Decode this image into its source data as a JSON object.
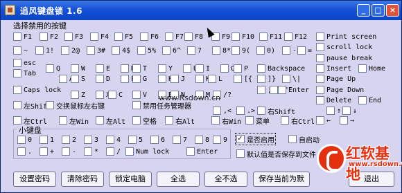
{
  "window": {
    "title": "追风键盘锁 1.6",
    "min": "_",
    "max": "□",
    "close": "×"
  },
  "section_title": "选择禁用的按键",
  "keys": [
    {
      "id": "F1",
      "label": "F1",
      "checked": false
    },
    {
      "id": "F2",
      "label": "F2",
      "checked": false
    },
    {
      "id": "F3",
      "label": "F3",
      "checked": false
    },
    {
      "id": "F4",
      "label": "F4",
      "checked": false
    },
    {
      "id": "F5",
      "label": "F5",
      "checked": false
    },
    {
      "id": "F6",
      "label": "F6",
      "checked": false
    },
    {
      "id": "F7",
      "label": "F7",
      "checked": false
    },
    {
      "id": "F8",
      "label": "F8",
      "checked": false
    },
    {
      "id": "F9",
      "label": "F9",
      "checked": false
    },
    {
      "id": "F10",
      "label": "F10",
      "checked": false
    },
    {
      "id": "F11",
      "label": "F11",
      "checked": false
    },
    {
      "id": "F12",
      "label": "F12",
      "checked": false
    },
    {
      "id": "print-screen",
      "label": "Print screen",
      "checked": false
    },
    {
      "id": "tilde",
      "label": "~",
      "checked": false
    },
    {
      "id": "1",
      "label": "1!",
      "checked": false
    },
    {
      "id": "2",
      "label": "2@",
      "checked": false
    },
    {
      "id": "3",
      "label": "3#",
      "checked": false
    },
    {
      "id": "4",
      "label": "4$",
      "checked": false
    },
    {
      "id": "5",
      "label": "5%",
      "checked": false
    },
    {
      "id": "6",
      "label": "6^",
      "checked": false
    },
    {
      "id": "7",
      "label": "7",
      "checked": false
    },
    {
      "id": "8",
      "label": "8*",
      "checked": false
    },
    {
      "id": "9",
      "label": "9(",
      "checked": false
    },
    {
      "id": "0",
      "label": "0)",
      "checked": false
    },
    {
      "id": "minus",
      "label": "-",
      "checked": false
    },
    {
      "id": "equals",
      "label": "=",
      "checked": false
    },
    {
      "id": "scroll-lock",
      "label": "scroll lock",
      "checked": false
    },
    {
      "id": "esc",
      "label": "esc",
      "checked": false
    },
    {
      "id": "pause-break",
      "label": "pause break",
      "checked": false
    },
    {
      "id": "tab",
      "label": "Tab",
      "checked": false
    },
    {
      "id": "Q",
      "label": "Q",
      "checked": false
    },
    {
      "id": "W",
      "label": "W",
      "checked": false
    },
    {
      "id": "E",
      "label": "E",
      "checked": false
    },
    {
      "id": "R",
      "label": "R",
      "checked": false
    },
    {
      "id": "T",
      "label": "T",
      "checked": false
    },
    {
      "id": "Y",
      "label": "Y",
      "checked": false
    },
    {
      "id": "U",
      "label": "U",
      "checked": false
    },
    {
      "id": "I",
      "label": "I",
      "checked": false
    },
    {
      "id": "O",
      "label": "O",
      "checked": false
    },
    {
      "id": "P",
      "label": "P",
      "checked": false
    },
    {
      "id": "backspace",
      "label": "Backspace",
      "checked": false
    },
    {
      "id": "insert",
      "label": "Insert",
      "checked": false
    },
    {
      "id": "home",
      "label": "Home",
      "checked": false
    },
    {
      "id": "A",
      "label": "A",
      "checked": false
    },
    {
      "id": "S",
      "label": "S",
      "checked": false
    },
    {
      "id": "D",
      "label": "D",
      "checked": false
    },
    {
      "id": "F",
      "label": "F",
      "checked": false
    },
    {
      "id": "G",
      "label": "G",
      "checked": false
    },
    {
      "id": "H",
      "label": "H",
      "checked": false
    },
    {
      "id": "J",
      "label": "J",
      "checked": false
    },
    {
      "id": "K",
      "label": "K",
      "checked": false
    },
    {
      "id": "L",
      "label": "L",
      "checked": false
    },
    {
      "id": "brackets",
      "label": "[{",
      "checked": false
    },
    {
      "id": "rbrackets",
      "label": "]}",
      "checked": false
    },
    {
      "id": "backslash",
      "label": "\\|",
      "checked": false
    },
    {
      "id": "page-up",
      "label": "Page Up",
      "checked": false
    },
    {
      "id": "caps-lock",
      "label": "Caps lock",
      "checked": false
    },
    {
      "id": "semicolon",
      "label": ";:",
      "checked": false
    },
    {
      "id": "quote",
      "label": "'\"",
      "checked": false
    },
    {
      "id": "enter",
      "label": "Enter",
      "checked": false
    },
    {
      "id": "page-down",
      "label": "Page Down",
      "checked": false
    },
    {
      "id": "Z",
      "label": "Z",
      "checked": false
    },
    {
      "id": "X",
      "label": "X",
      "checked": false
    },
    {
      "id": "C",
      "label": "C",
      "checked": false
    },
    {
      "id": "V",
      "label": "V",
      "checked": false
    },
    {
      "id": "B",
      "label": "B",
      "checked": false
    },
    {
      "id": "N",
      "label": "N",
      "checked": false
    },
    {
      "id": "M",
      "label": "M",
      "checked": false
    },
    {
      "id": "slash",
      "label": "/?",
      "checked": false
    },
    {
      "id": "delete",
      "label": "Delete",
      "checked": false
    },
    {
      "id": "end",
      "label": "End",
      "checked": false
    },
    {
      "id": "left-shift",
      "label": "左Shift",
      "checked": false
    },
    {
      "id": "swap-mouse",
      "label": "交换鼠标左右键",
      "checked": false
    },
    {
      "id": "disable-taskmgr",
      "label": "禁用任务管理器",
      "checked": false
    },
    {
      "id": "comma",
      "label": ",<",
      "checked": false
    },
    {
      "id": "period",
      "label": ".>",
      "checked": false
    },
    {
      "id": "right-shift",
      "label": "右Shift",
      "checked": false
    },
    {
      "id": "up-arrow",
      "label": "↑",
      "checked": false
    },
    {
      "id": "down-arrow",
      "label": "↓",
      "checked": false
    },
    {
      "id": "left-ctrl",
      "label": "左Ctrl",
      "checked": false
    },
    {
      "id": "left-win",
      "label": "左Win",
      "checked": false
    },
    {
      "id": "left-alt",
      "label": "左Alt",
      "checked": false
    },
    {
      "id": "space",
      "label": "空格",
      "checked": false
    },
    {
      "id": "right-alt",
      "label": "右Alt",
      "checked": false
    },
    {
      "id": "right-win",
      "label": "右Win",
      "checked": false
    },
    {
      "id": "menu",
      "label": "菜单",
      "checked": false
    },
    {
      "id": "right-ctrl",
      "label": "右Ctrl",
      "checked": false
    },
    {
      "id": "left-arrow",
      "label": "←",
      "checked": false
    },
    {
      "id": "right-arrow",
      "label": "→",
      "checked": false
    }
  ],
  "numpad": {
    "title": "小键盘",
    "keys": [
      {
        "label": "0"
      },
      {
        "label": "1"
      },
      {
        "label": "2"
      },
      {
        "label": "3"
      },
      {
        "label": "4"
      },
      {
        "label": "5"
      },
      {
        "label": "6"
      },
      {
        "label": "7"
      },
      {
        "label": "8"
      },
      {
        "label": "9"
      },
      {
        "label": "."
      },
      {
        "label": "+"
      },
      {
        "label": "-"
      },
      {
        "label": "*"
      },
      {
        "label": "/"
      },
      {
        "label": "Num lock"
      },
      {
        "label": "Enter"
      }
    ]
  },
  "options": {
    "enable": {
      "label": "是否启用",
      "checked": true
    },
    "autostart": {
      "label": "自启动",
      "checked": false
    },
    "default_saved": {
      "label": "默认值是否保存到文件",
      "checked": false
    }
  },
  "watermark_url": "www.Rsdown.cn",
  "logo": {
    "name": "红软基地",
    "url": "www.rsdown.cn"
  },
  "buttons": {
    "set_password": "设置密码",
    "clear_password": "清除密码",
    "lock_computer": "锁定电脑",
    "select_all": "全选",
    "deselect_all": "全不选",
    "save_default": "保存当前为默",
    "exit": "退出"
  }
}
